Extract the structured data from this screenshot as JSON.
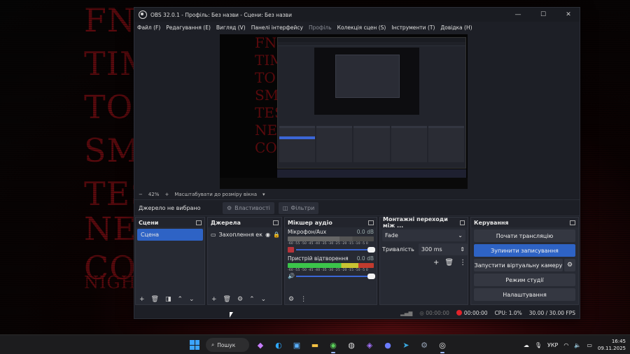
{
  "desktop": {
    "bg_lines": [
      "FN",
      "TIM",
      "TO",
      "SM",
      "TES",
      "NE",
      "CO",
      "NIGH"
    ]
  },
  "window": {
    "title": "OBS 32.0.1 - Профіль: Без назви - Сцени: Без назви",
    "controls": {
      "minimize": "—",
      "maximize": "☐",
      "close": "✕"
    }
  },
  "menu": {
    "items": [
      {
        "label": "Файл (F)",
        "disabled": false
      },
      {
        "label": "Редагування (E)",
        "disabled": false
      },
      {
        "label": "Вигляд (V)",
        "disabled": false
      },
      {
        "label": "Панелі інтерфейсу",
        "disabled": false
      },
      {
        "label": "Профіль",
        "disabled": true
      },
      {
        "label": "Колекція сцен (S)",
        "disabled": false
      },
      {
        "label": "Інструменти (T)",
        "disabled": false
      },
      {
        "label": "Довідка (H)",
        "disabled": false
      }
    ]
  },
  "zoom": {
    "minus": "−",
    "level": "42%",
    "plus": "+",
    "fit_label": "Масштабувати до розміру вікна",
    "caret": "▾"
  },
  "source_bar": {
    "no_source": "Джерело не вибрано",
    "properties": "Властивості",
    "filters": "Фільтри"
  },
  "scenes": {
    "title": "Сцени",
    "items": [
      "Сцена"
    ],
    "footer_icons": [
      "plus-icon",
      "trash-icon",
      "filter-icon",
      "arrow-up-icon",
      "arrow-down-icon"
    ]
  },
  "sources": {
    "title": "Джерела",
    "items": [
      {
        "name": "Захоплення ек",
        "icon": "monitor-icon"
      }
    ],
    "footer_icons": [
      "plus-icon",
      "trash-icon",
      "gear-icon",
      "arrow-up-icon",
      "arrow-down-icon"
    ]
  },
  "mixer": {
    "title": "Мікшер аудіо",
    "ticks": "-60 -55 -50 -45 -40 -35 -30 -25 -20 -15 -10 -5 0",
    "channels": [
      {
        "name": "Мікрофон/Aux",
        "db": "0.0 dB",
        "muted": true,
        "level": 0.75
      },
      {
        "name": "Пристрій відтворення",
        "db": "0.0 dB",
        "muted": false,
        "level": 0.9
      }
    ]
  },
  "transitions": {
    "title": "Монтажні переходи між ...",
    "selected": "Fade",
    "duration_label": "Тривалість",
    "duration_value": "300 ms"
  },
  "controls": {
    "title": "Керування",
    "start_stream": "Почати трансляцію",
    "stop_recording": "Зупинити записування",
    "start_virtualcam": "Запустити віртуальну камеру",
    "studio_mode": "Режим студії",
    "settings": "Налаштування"
  },
  "status": {
    "stream_time": "00:00:00",
    "rec_time": "00:00:00",
    "cpu": "CPU: 1.0%",
    "fps": "30.00 / 30.00 FPS"
  },
  "taskbar": {
    "search_label": "Пошук",
    "lang": "УКР",
    "time": "16:45",
    "date": "09.11.2025",
    "colors": {
      "accent": "#2e63c5",
      "record": "#e0232a"
    }
  }
}
